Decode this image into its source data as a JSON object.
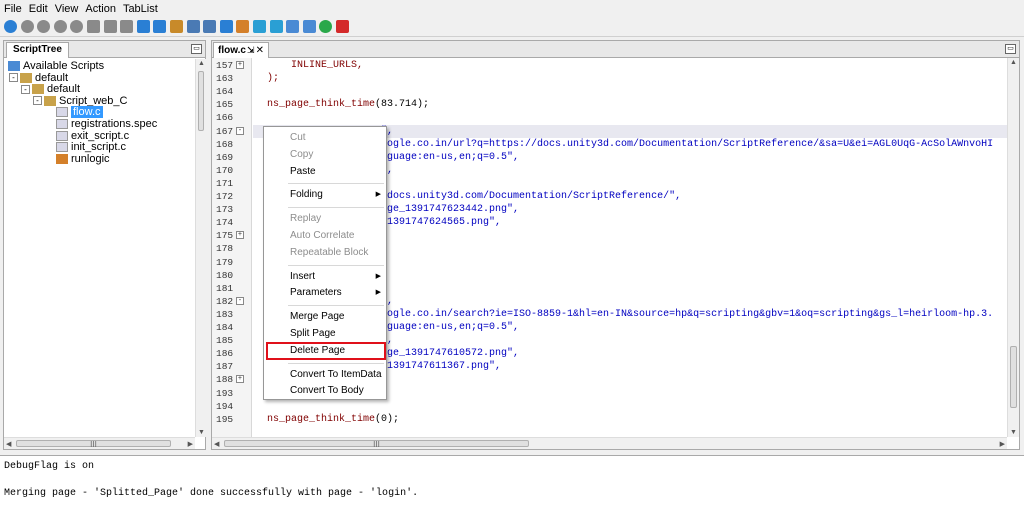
{
  "menu": [
    "File",
    "Edit",
    "View",
    "Action",
    "TabList"
  ],
  "toolbar_icons": [
    {
      "name": "run-icon",
      "color": "#2a7fd4"
    },
    {
      "name": "stop-icon",
      "color": "#8a8a8a"
    },
    {
      "name": "cancel-icon",
      "color": "#8a8a8a"
    },
    {
      "name": "pause-icon",
      "color": "#8a8a8a"
    },
    {
      "name": "step-icon",
      "color": "#8a8a8a"
    },
    {
      "name": "comment-icon",
      "color": "#8a8a8a"
    },
    {
      "name": "doc-icon",
      "color": "#8a8a8a"
    },
    {
      "name": "copy-icon",
      "color": "#8a8a8a"
    },
    {
      "name": "down-arrow-icon",
      "color": "#2a7fd4"
    },
    {
      "name": "up-arrow-icon",
      "color": "#2a7fd4"
    },
    {
      "name": "link-icon",
      "color": "#c88a2a"
    },
    {
      "name": "find-icon",
      "color": "#4a7ab4"
    },
    {
      "name": "find-replace-icon",
      "color": "#4a7ab4"
    },
    {
      "name": "settings-icon",
      "color": "#2a7fd4"
    },
    {
      "name": "edit-icon",
      "color": "#d4802a"
    },
    {
      "name": "info-icon",
      "color": "#2a9fd4"
    },
    {
      "name": "network-icon",
      "color": "#2a9fd4"
    },
    {
      "name": "monitor-icon",
      "color": "#4a8ad4"
    },
    {
      "name": "chart-icon",
      "color": "#4a8ad4"
    },
    {
      "name": "go-icon",
      "color": "#2aa84a"
    },
    {
      "name": "exit-icon",
      "color": "#d42a2a"
    }
  ],
  "left_panel": {
    "tab": "ScriptTree",
    "tree": [
      {
        "label": "Available Scripts",
        "level": 0,
        "icon": "scripts-root-icon"
      },
      {
        "label": "default",
        "level": 1,
        "icon": "folder-icon",
        "expander": "-"
      },
      {
        "label": "default",
        "level": 2,
        "icon": "folder-icon",
        "expander": "-"
      },
      {
        "label": "Script_web_C",
        "level": 3,
        "icon": "folder-icon",
        "expander": "-"
      },
      {
        "label": "flow.c",
        "level": 4,
        "icon": "file-icon",
        "selected": true
      },
      {
        "label": "registrations.spec",
        "level": 4,
        "icon": "file-icon"
      },
      {
        "label": "exit_script.c",
        "level": 4,
        "icon": "file-icon"
      },
      {
        "label": "init_script.c",
        "level": 4,
        "icon": "file-icon"
      },
      {
        "label": "runlogic",
        "level": 4,
        "icon": "runlogic-icon"
      }
    ],
    "hscroll_label": "III"
  },
  "editor": {
    "tab": "flow.c",
    "hscroll_label": "III",
    "lines": [
      {
        "n": "157",
        "fold": "+",
        "parts": [
          {
            "t": "    INLINE_URLS,",
            "c": "kw"
          }
        ]
      },
      {
        "n": "163",
        "parts": [
          {
            "t": ");",
            "c": "kw"
          }
        ]
      },
      {
        "n": "164",
        "parts": []
      },
      {
        "n": "165",
        "parts": [
          {
            "t": "ns_page_think_time",
            "c": "kw"
          },
          {
            "t": "(83.714);",
            "c": "num"
          }
        ]
      },
      {
        "n": "166",
        "parts": []
      },
      {
        "n": "167",
        "fold": "-",
        "highlight": true,
        "parts": [
          {
            "t": "                   \",",
            "c": "str"
          }
        ]
      },
      {
        "n": "168",
        "parts": [
          {
            "t": "                  google.co.in/url?q=https://docs.unity3d.com/Documentation/ScriptReference/&sa=U&ei=AGL0UqG-AcSolAWnvoHI",
            "c": "str"
          }
        ]
      },
      {
        "n": "169",
        "parts": [
          {
            "t": "                  anguage:en-us,en;q=0.5\",",
            "c": "str"
          }
        ]
      },
      {
        "n": "170",
        "parts": [
          {
            "t": "                  ;\",",
            "c": "str"
          }
        ]
      },
      {
        "n": "171",
        "parts": []
      },
      {
        "n": "172",
        "parts": [
          {
            "t": "                  //docs.unity3d.com/Documentation/ScriptReference/\",",
            "c": "str"
          }
        ]
      },
      {
        "n": "173",
        "parts": [
          {
            "t": "                  page_1391747623442.png\",",
            "c": "str"
          }
        ]
      },
      {
        "n": "174",
        "parts": [
          {
            "t": "                  e_1391747624565.png\",",
            "c": "str"
          }
        ]
      },
      {
        "n": "175",
        "fold": "+",
        "parts": []
      },
      {
        "n": "178",
        "parts": []
      },
      {
        "n": "179",
        "parts": []
      },
      {
        "n": "180",
        "parts": [
          {
            "t": "                  );",
            "c": "kw"
          }
        ]
      },
      {
        "n": "181",
        "parts": []
      },
      {
        "n": "182",
        "fold": "-",
        "parts": [
          {
            "t": "                  2\",",
            "c": "str"
          }
        ]
      },
      {
        "n": "183",
        "parts": [
          {
            "t": "                  google.co.in/search?ie=ISO-8859-1&hl=en-IN&source=hp&q=scripting&gbv=1&oq=scripting&gs_l=heirloom-hp.3.",
            "c": "str"
          }
        ]
      },
      {
        "n": "184",
        "parts": [
          {
            "t": "                  anguage:en-us,en;q=0.5\",",
            "c": "str"
          }
        ]
      },
      {
        "n": "185",
        "parts": [
          {
            "t": "                  ;\",",
            "c": "str"
          }
        ]
      },
      {
        "n": "186",
        "parts": [
          {
            "t": "                  page_1391747610572.png\",",
            "c": "str"
          }
        ]
      },
      {
        "n": "187",
        "parts": [
          {
            "t": "                  e_1391747611367.png\",",
            "c": "str"
          }
        ]
      },
      {
        "n": "188",
        "fold": "+",
        "parts": []
      },
      {
        "n": "193",
        "parts": [
          {
            "t": ");",
            "c": "kw"
          }
        ]
      },
      {
        "n": "194",
        "parts": []
      },
      {
        "n": "195",
        "parts": [
          {
            "t": "ns_page_think_time",
            "c": "kw"
          },
          {
            "t": "(0);",
            "c": "num"
          }
        ]
      }
    ]
  },
  "context_menu": [
    {
      "label": "Cut",
      "disabled": true
    },
    {
      "label": "Copy",
      "disabled": true
    },
    {
      "label": "Paste",
      "disabled": false
    },
    {
      "sep": true
    },
    {
      "label": "Folding",
      "submenu": true
    },
    {
      "sep": true
    },
    {
      "label": "Replay",
      "disabled": true
    },
    {
      "label": "Auto Correlate",
      "disabled": true
    },
    {
      "label": "Repeatable Block",
      "disabled": true
    },
    {
      "sep": true
    },
    {
      "label": "Insert",
      "submenu": true
    },
    {
      "label": "Parameters",
      "submenu": true
    },
    {
      "sep": true
    },
    {
      "label": "Merge Page"
    },
    {
      "label": "Split Page"
    },
    {
      "label": "Delete Page",
      "highlighted": true
    },
    {
      "sep": true
    },
    {
      "label": "Convert To ItemData"
    },
    {
      "label": "Convert To Body"
    }
  ],
  "console": {
    "lines": [
      "DebugFlag is on",
      "",
      "Merging page - 'Splitted_Page' done successfully with page - 'login'."
    ]
  },
  "colors": {
    "keyword": "#800000",
    "string": "#0000c0",
    "selection": "#3399ff",
    "highlight_box": "#e0101a"
  }
}
